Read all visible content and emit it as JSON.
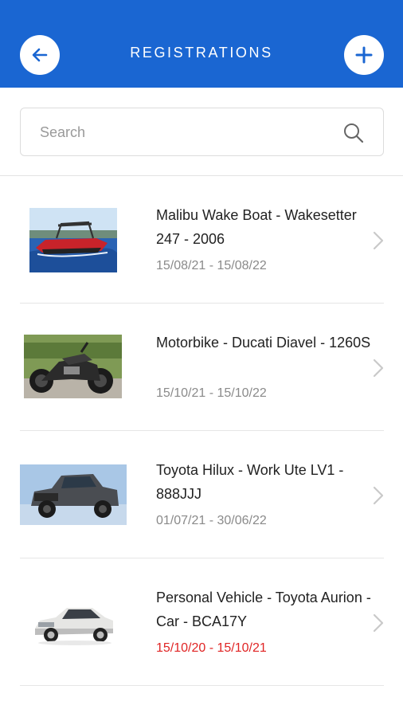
{
  "header": {
    "title": "REGISTRATIONS",
    "back_icon": "arrow-left-icon",
    "add_icon": "plus-icon",
    "color": "#1a66d2"
  },
  "search": {
    "placeholder": "Search",
    "value": "",
    "icon": "search-icon"
  },
  "registrations": [
    {
      "title": "Malibu Wake Boat - Wakesetter 247 - 2006",
      "dates": "15/08/21 - 15/08/22",
      "expired": false,
      "thumbnail": "wake-boat-photo"
    },
    {
      "title": "Motorbike - Ducati Diavel - 1260S",
      "dates": "15/10/21 - 15/10/22",
      "expired": false,
      "thumbnail": "motorbike-photo"
    },
    {
      "title": "Toyota Hilux - Work Ute LV1 - 888JJJ",
      "dates": "01/07/21 - 30/06/22",
      "expired": false,
      "thumbnail": "ute-photo"
    },
    {
      "title": "Personal Vehicle - Toyota Aurion - Car - BCA17Y",
      "dates": "15/10/20 - 15/10/21",
      "expired": true,
      "thumbnail": "sedan-photo"
    }
  ],
  "colors": {
    "accent": "#1a66d2",
    "expired": "#e02424",
    "muted": "#8a8a8a"
  }
}
